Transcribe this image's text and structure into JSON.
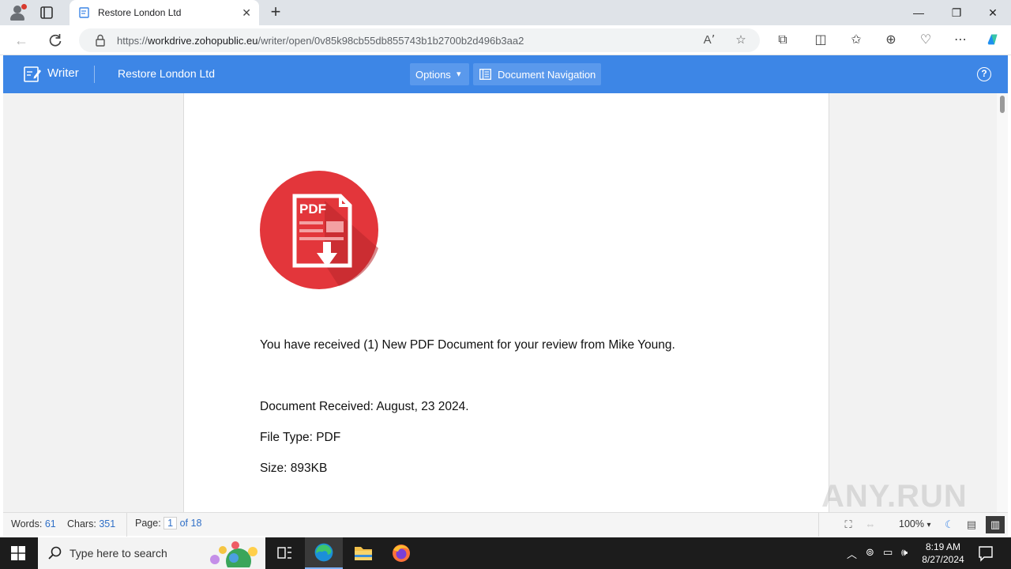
{
  "browser": {
    "tab_title": "Restore London Ltd",
    "tab_close": "✕",
    "new_tab": "+",
    "url_scheme": "https://",
    "url_host": "workdrive.zohopublic.eu",
    "url_path": "/writer/open/0v85k98cb55db855743b1b2700b2d496b3aa2",
    "window_controls": {
      "minimize": "—",
      "restore": "❐",
      "close": "✕"
    }
  },
  "app": {
    "brand": "Writer",
    "document_name": "Restore London Ltd",
    "options_label": "Options",
    "doc_nav_label": "Document Navigation",
    "help_label": "?"
  },
  "document": {
    "lines": [
      "You have received (1) New PDF Document for your review from Mike Young.",
      "Document Received: August, 23 2024.",
      "File Type: PDF",
      "Size: 893KB"
    ],
    "icon_text": "PDF",
    "icon_color": "#e3363b"
  },
  "status": {
    "words_label": "Words:",
    "words_value": "61",
    "chars_label": "Chars:",
    "chars_value": "351",
    "page_label": "Page:",
    "page_current": "1",
    "page_total": "of 18",
    "zoom": "100%"
  },
  "watermark": "ANY.RUN",
  "taskbar": {
    "search_placeholder": "Type here to search",
    "time": "8:19 AM",
    "date": "8/27/2024"
  },
  "colors": {
    "app_header": "#3d86e6",
    "accent_link": "#2f6fc7"
  }
}
